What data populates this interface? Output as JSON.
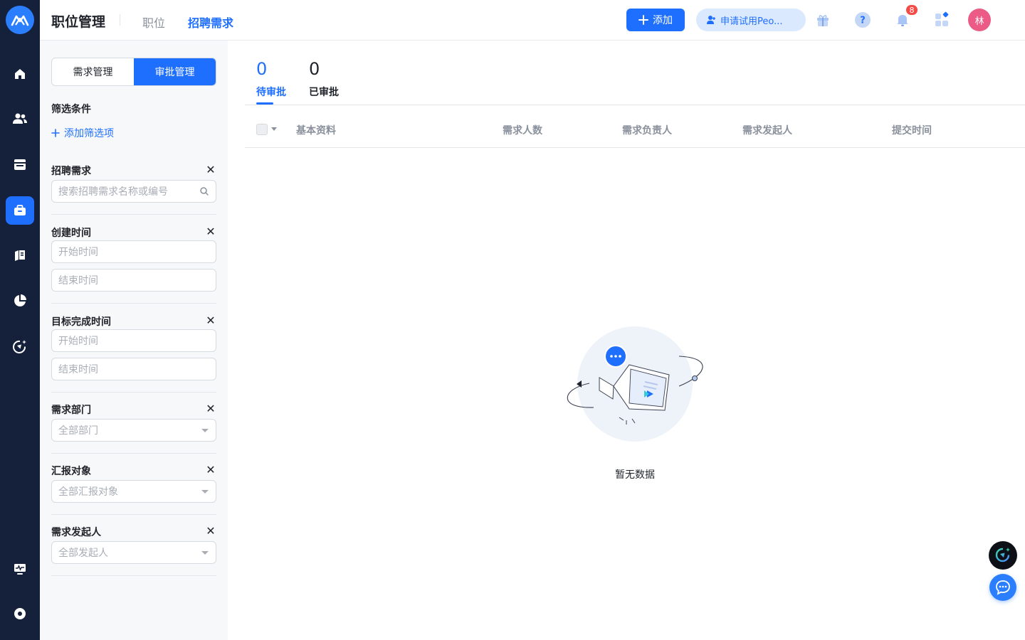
{
  "header": {
    "title": "职位管理",
    "tabs": [
      {
        "label": "职位",
        "active": false
      },
      {
        "label": "招聘需求",
        "active": true
      }
    ],
    "add_label": "添加",
    "trial_label": "申请试用Peo...",
    "notification_count": "8",
    "avatar_text": "林"
  },
  "sidebar": {
    "segments": [
      {
        "label": "需求管理",
        "active": false
      },
      {
        "label": "审批管理",
        "active": true
      }
    ],
    "filter_title": "筛选条件",
    "add_filter_label": "添加筛选项",
    "groups": [
      {
        "label": "招聘需求",
        "inputs": [
          {
            "placeholder": "搜索招聘需求名称或编号",
            "kind": "search"
          }
        ]
      },
      {
        "label": "创建时间",
        "inputs": [
          {
            "placeholder": "开始时间",
            "kind": "text"
          },
          {
            "placeholder": "结束时间",
            "kind": "text"
          }
        ]
      },
      {
        "label": "目标完成时间",
        "inputs": [
          {
            "placeholder": "开始时间",
            "kind": "text"
          },
          {
            "placeholder": "结束时间",
            "kind": "text"
          }
        ]
      },
      {
        "label": "需求部门",
        "inputs": [
          {
            "placeholder": "全部部门",
            "kind": "select"
          }
        ]
      },
      {
        "label": "汇报对象",
        "inputs": [
          {
            "placeholder": "全部汇报对象",
            "kind": "select"
          }
        ]
      },
      {
        "label": "需求发起人",
        "inputs": [
          {
            "placeholder": "全部发起人",
            "kind": "select"
          }
        ]
      }
    ]
  },
  "main": {
    "stats": [
      {
        "value": "0",
        "label": "待审批",
        "active": true
      },
      {
        "value": "0",
        "label": "已审批",
        "active": false
      }
    ],
    "columns": [
      "基本资料",
      "需求人数",
      "需求负责人",
      "需求发起人",
      "提交时间"
    ],
    "empty_text": "暂无数据"
  },
  "colors": {
    "accent": "#1f6fff",
    "nav_bg": "#15203a",
    "badge": "#f54a45",
    "avatar": "#eb5b86"
  },
  "icons": {
    "left_nav": [
      "home-icon",
      "users-icon",
      "calendar-icon",
      "briefcase-icon",
      "book-icon",
      "pie-chart-icon",
      "ai-assistant-icon",
      "monitor-icon",
      "settings-dot-icon"
    ],
    "header": [
      "gift-icon",
      "help-icon",
      "bell-icon",
      "apps-icon"
    ]
  }
}
